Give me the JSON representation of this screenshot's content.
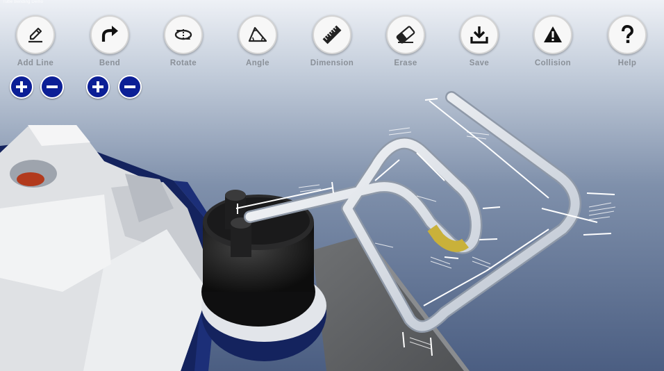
{
  "app": {
    "title": "Tube Bending Demo"
  },
  "toolbar": {
    "tools": [
      {
        "label": "Add Line",
        "icon": "pencil-icon"
      },
      {
        "label": "Bend",
        "icon": "curved-arrow-icon"
      },
      {
        "label": "Rotate",
        "icon": "rotate-icon"
      },
      {
        "label": "Angle",
        "icon": "angle-icon"
      },
      {
        "label": "Dimension",
        "icon": "ruler-icon"
      },
      {
        "label": "Erase",
        "icon": "eraser-icon"
      },
      {
        "label": "Save",
        "icon": "download-icon"
      },
      {
        "label": "Collision",
        "icon": "warning-icon"
      },
      {
        "label": "Help",
        "icon": "question-icon"
      }
    ]
  },
  "line_controls": {
    "increase_icon": "plus-icon",
    "decrease_icon": "minus-icon"
  },
  "bend_controls": {
    "increase_icon": "plus-icon",
    "decrease_icon": "minus-icon"
  },
  "colors": {
    "button_fill": "#0c1f96",
    "tube": "#e8ecf2",
    "selected_bend": "#c9b13a",
    "machine_blue": "#14235e"
  }
}
